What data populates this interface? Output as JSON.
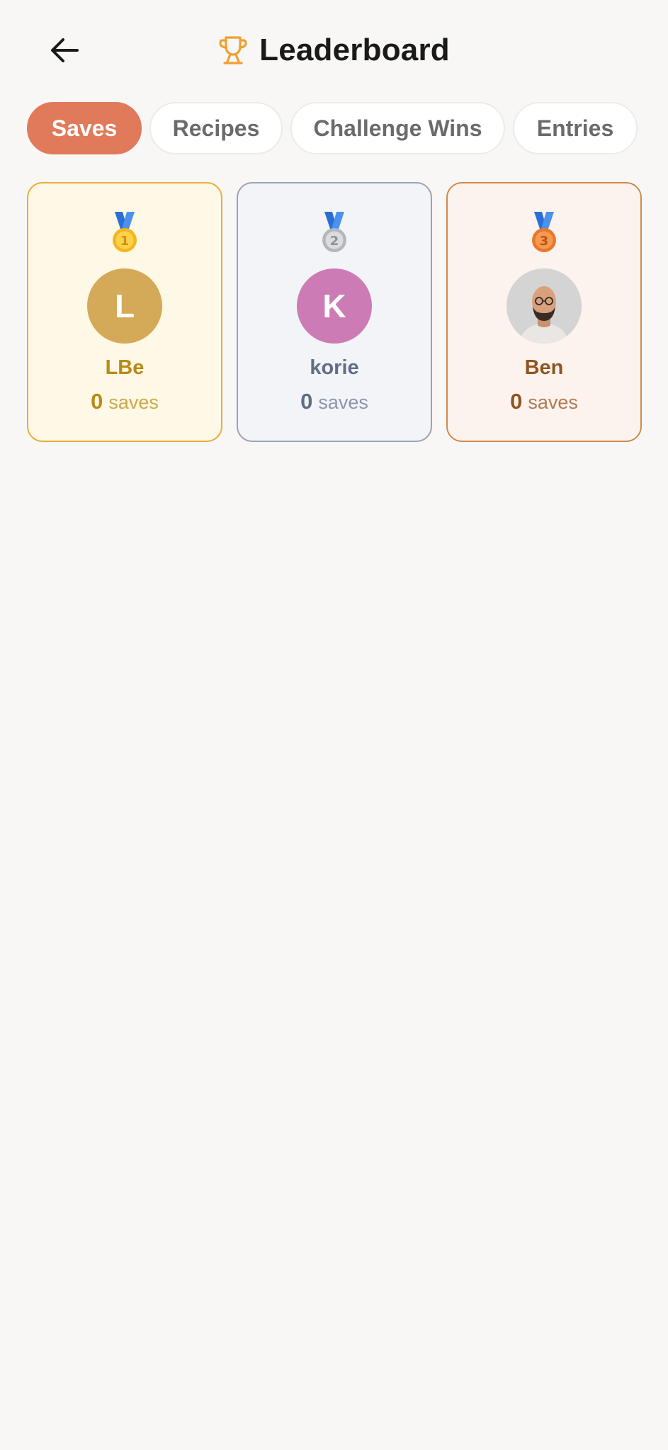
{
  "header": {
    "title": "Leaderboard"
  },
  "tabs": [
    {
      "label": "Saves",
      "active": true
    },
    {
      "label": "Recipes",
      "active": false
    },
    {
      "label": "Challenge Wins",
      "active": false
    },
    {
      "label": "Entries",
      "active": false
    }
  ],
  "podium": [
    {
      "rank": 1,
      "medal": "gold-medal-icon",
      "initial": "L",
      "name": "LBe",
      "count": "0",
      "unit": "saves",
      "colors": {
        "avatar": "#d4a957",
        "name": "#b98a16",
        "unit": "#c9a94a"
      }
    },
    {
      "rank": 2,
      "medal": "silver-medal-icon",
      "initial": "K",
      "name": "korie",
      "count": "0",
      "unit": "saves",
      "colors": {
        "avatar": "#cc7bb5",
        "name": "#5f6e85",
        "unit": "#8a97aa"
      }
    },
    {
      "rank": 3,
      "medal": "bronze-medal-icon",
      "initial": "",
      "name": "Ben",
      "count": "0",
      "unit": "saves",
      "colors": {
        "avatar": "#d3d3d3",
        "name": "#8e561f",
        "unit": "#b07a52"
      }
    }
  ],
  "colors": {
    "accent": "#e07a5a",
    "trophy": "#f0a030",
    "background": "#f8f7f5"
  }
}
